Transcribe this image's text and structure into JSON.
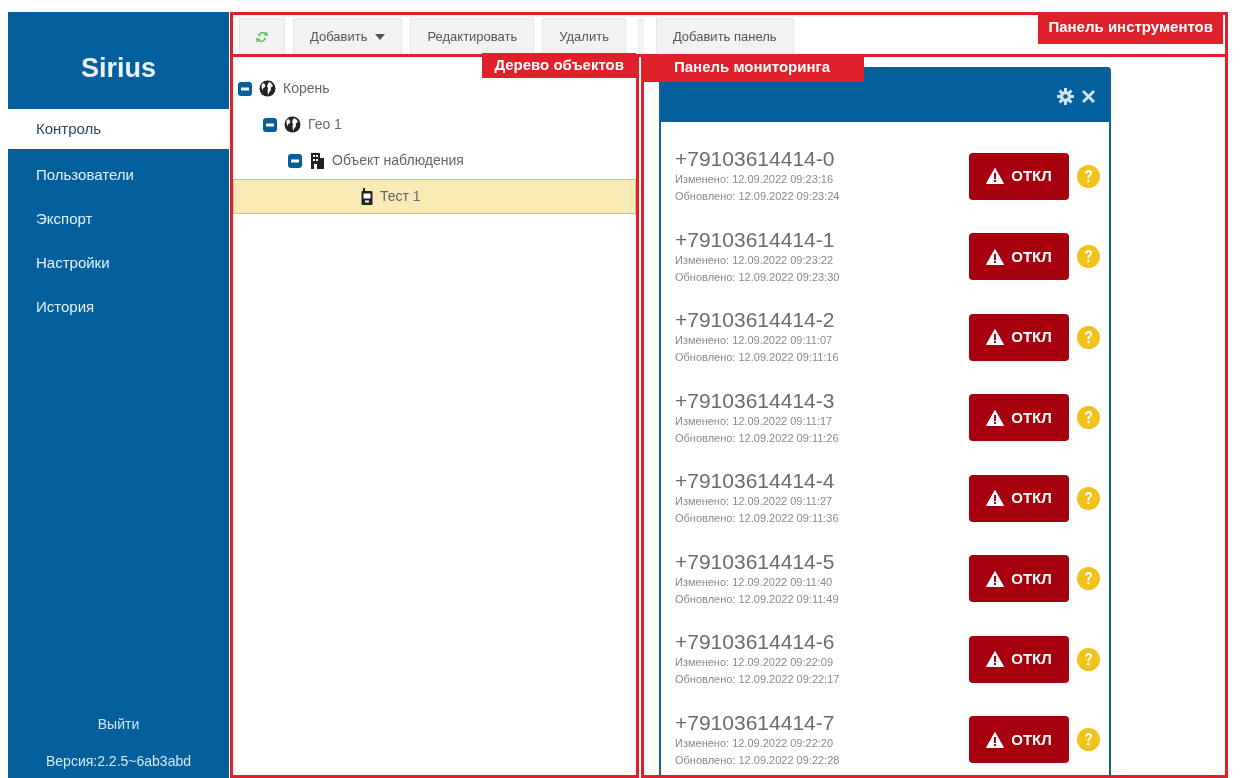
{
  "sidebar": {
    "title": "Sirius",
    "items": [
      {
        "label": "Контроль",
        "selected": true
      },
      {
        "label": "Пользователи",
        "selected": false
      },
      {
        "label": "Экспорт",
        "selected": false
      },
      {
        "label": "Настройки",
        "selected": false
      },
      {
        "label": "История",
        "selected": false
      }
    ],
    "logout": "Выйти",
    "version": "Версия:2.2.5~6ab3abd"
  },
  "toolbar": {
    "annotation": "Панель инструментов",
    "tree_buttons": [
      {
        "kind": "refresh"
      },
      {
        "kind": "dropdown",
        "label": "Добавить"
      },
      {
        "kind": "button",
        "label": "Редактировать"
      },
      {
        "kind": "button",
        "label": "Удалить"
      }
    ],
    "panel_buttons": [
      {
        "kind": "button",
        "label": "Добавить панель"
      }
    ]
  },
  "tree": {
    "annotation": "Дерево объектов",
    "nodes": [
      {
        "label": "Корень",
        "kind": "globe",
        "expanded": true,
        "selected": false,
        "children": [
          {
            "label": "Гео 1",
            "kind": "globe",
            "expanded": true,
            "selected": false,
            "children": [
              {
                "label": "Объект наблюдения",
                "kind": "building",
                "expanded": true,
                "selected": false,
                "children": [
                  {
                    "label": "Тест 1",
                    "kind": "device",
                    "selected": true
                  }
                ]
              }
            ]
          }
        ]
      }
    ]
  },
  "monitor": {
    "annotation": "Панель мониторинга",
    "rows": [
      {
        "phone": "+79103614414-0",
        "changed": "Изменено: 12.09.2022 09:23:16",
        "updated": "Обновлено: 12.09.2022 09:23:24",
        "status": "ОТКЛ"
      },
      {
        "phone": "+79103614414-1",
        "changed": "Изменено: 12.09.2022 09:23:22",
        "updated": "Обновлено: 12.09.2022 09:23:30",
        "status": "ОТКЛ"
      },
      {
        "phone": "+79103614414-2",
        "changed": "Изменено: 12.09.2022 09:11:07",
        "updated": "Обновлено: 12.09.2022 09:11:16",
        "status": "ОТКЛ"
      },
      {
        "phone": "+79103614414-3",
        "changed": "Изменено: 12.09.2022 09:11:17",
        "updated": "Обновлено: 12.09.2022 09:11:26",
        "status": "ОТКЛ"
      },
      {
        "phone": "+79103614414-4",
        "changed": "Изменено: 12.09.2022 09:11:27",
        "updated": "Обновлено: 12.09.2022 09:11:36",
        "status": "ОТКЛ"
      },
      {
        "phone": "+79103614414-5",
        "changed": "Изменено: 12.09.2022 09:11:40",
        "updated": "Обновлено: 12.09.2022 09:11:49",
        "status": "ОТКЛ"
      },
      {
        "phone": "+79103614414-6",
        "changed": "Изменено: 12.09.2022 09:22:09",
        "updated": "Обновлено: 12.09.2022 09:22:17",
        "status": "ОТКЛ"
      },
      {
        "phone": "+79103614414-7",
        "changed": "Изменено: 12.09.2022 09:22:20",
        "updated": "Обновлено: 12.09.2022 09:22:28",
        "status": "ОТКЛ"
      }
    ]
  }
}
